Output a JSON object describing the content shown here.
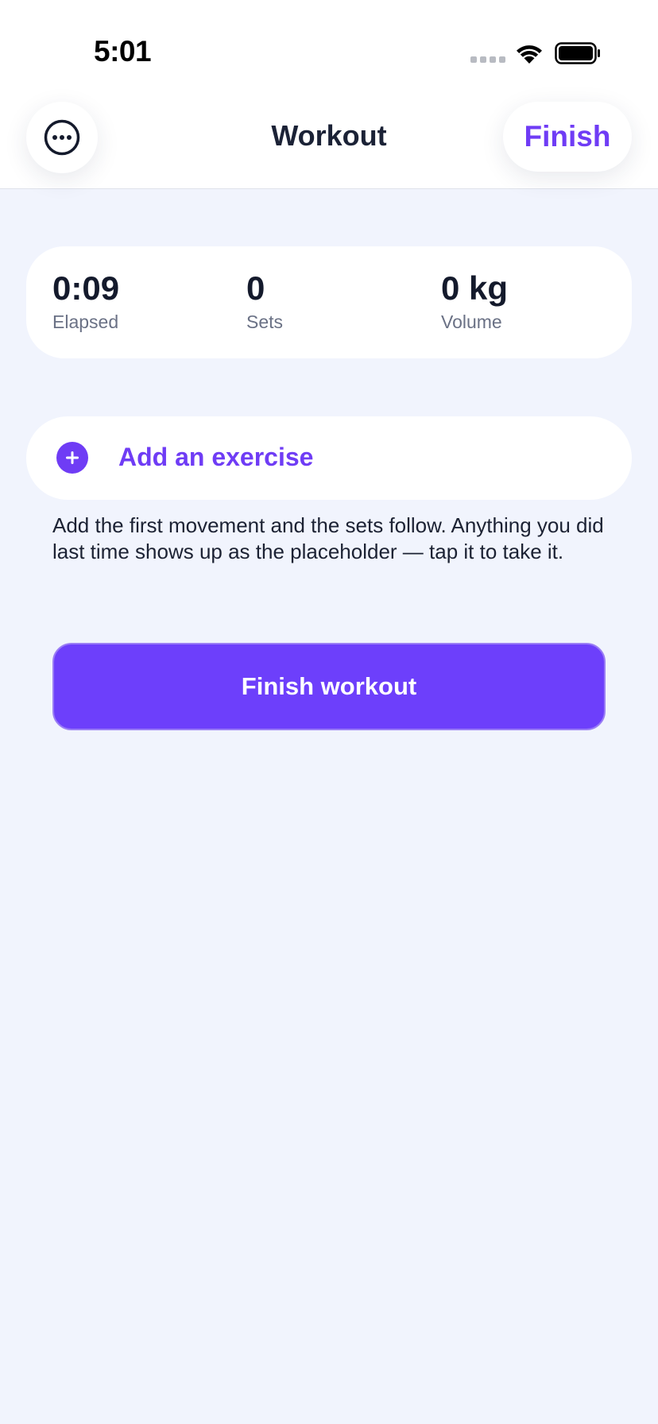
{
  "status_bar": {
    "time": "5:01"
  },
  "nav": {
    "more_icon": "ellipsis-circle-icon",
    "title": "Workout",
    "finish_label": "Finish"
  },
  "stats": [
    {
      "value": "0:09",
      "label": "Elapsed"
    },
    {
      "value": "0",
      "label": "Sets"
    },
    {
      "value": "0 kg",
      "label": "Volume"
    }
  ],
  "add_exercise": {
    "icon": "plus-circle-icon",
    "label": "Add an exercise"
  },
  "hint_text": "Add the first movement and the sets follow. Anything you did last time shows up as the placeholder — tap it to take it.",
  "finish_workout_label": "Finish workout",
  "colors": {
    "accent": "#6f3cf5",
    "background": "#f1f4fd",
    "card": "#ffffff",
    "text": "#1a2033"
  }
}
